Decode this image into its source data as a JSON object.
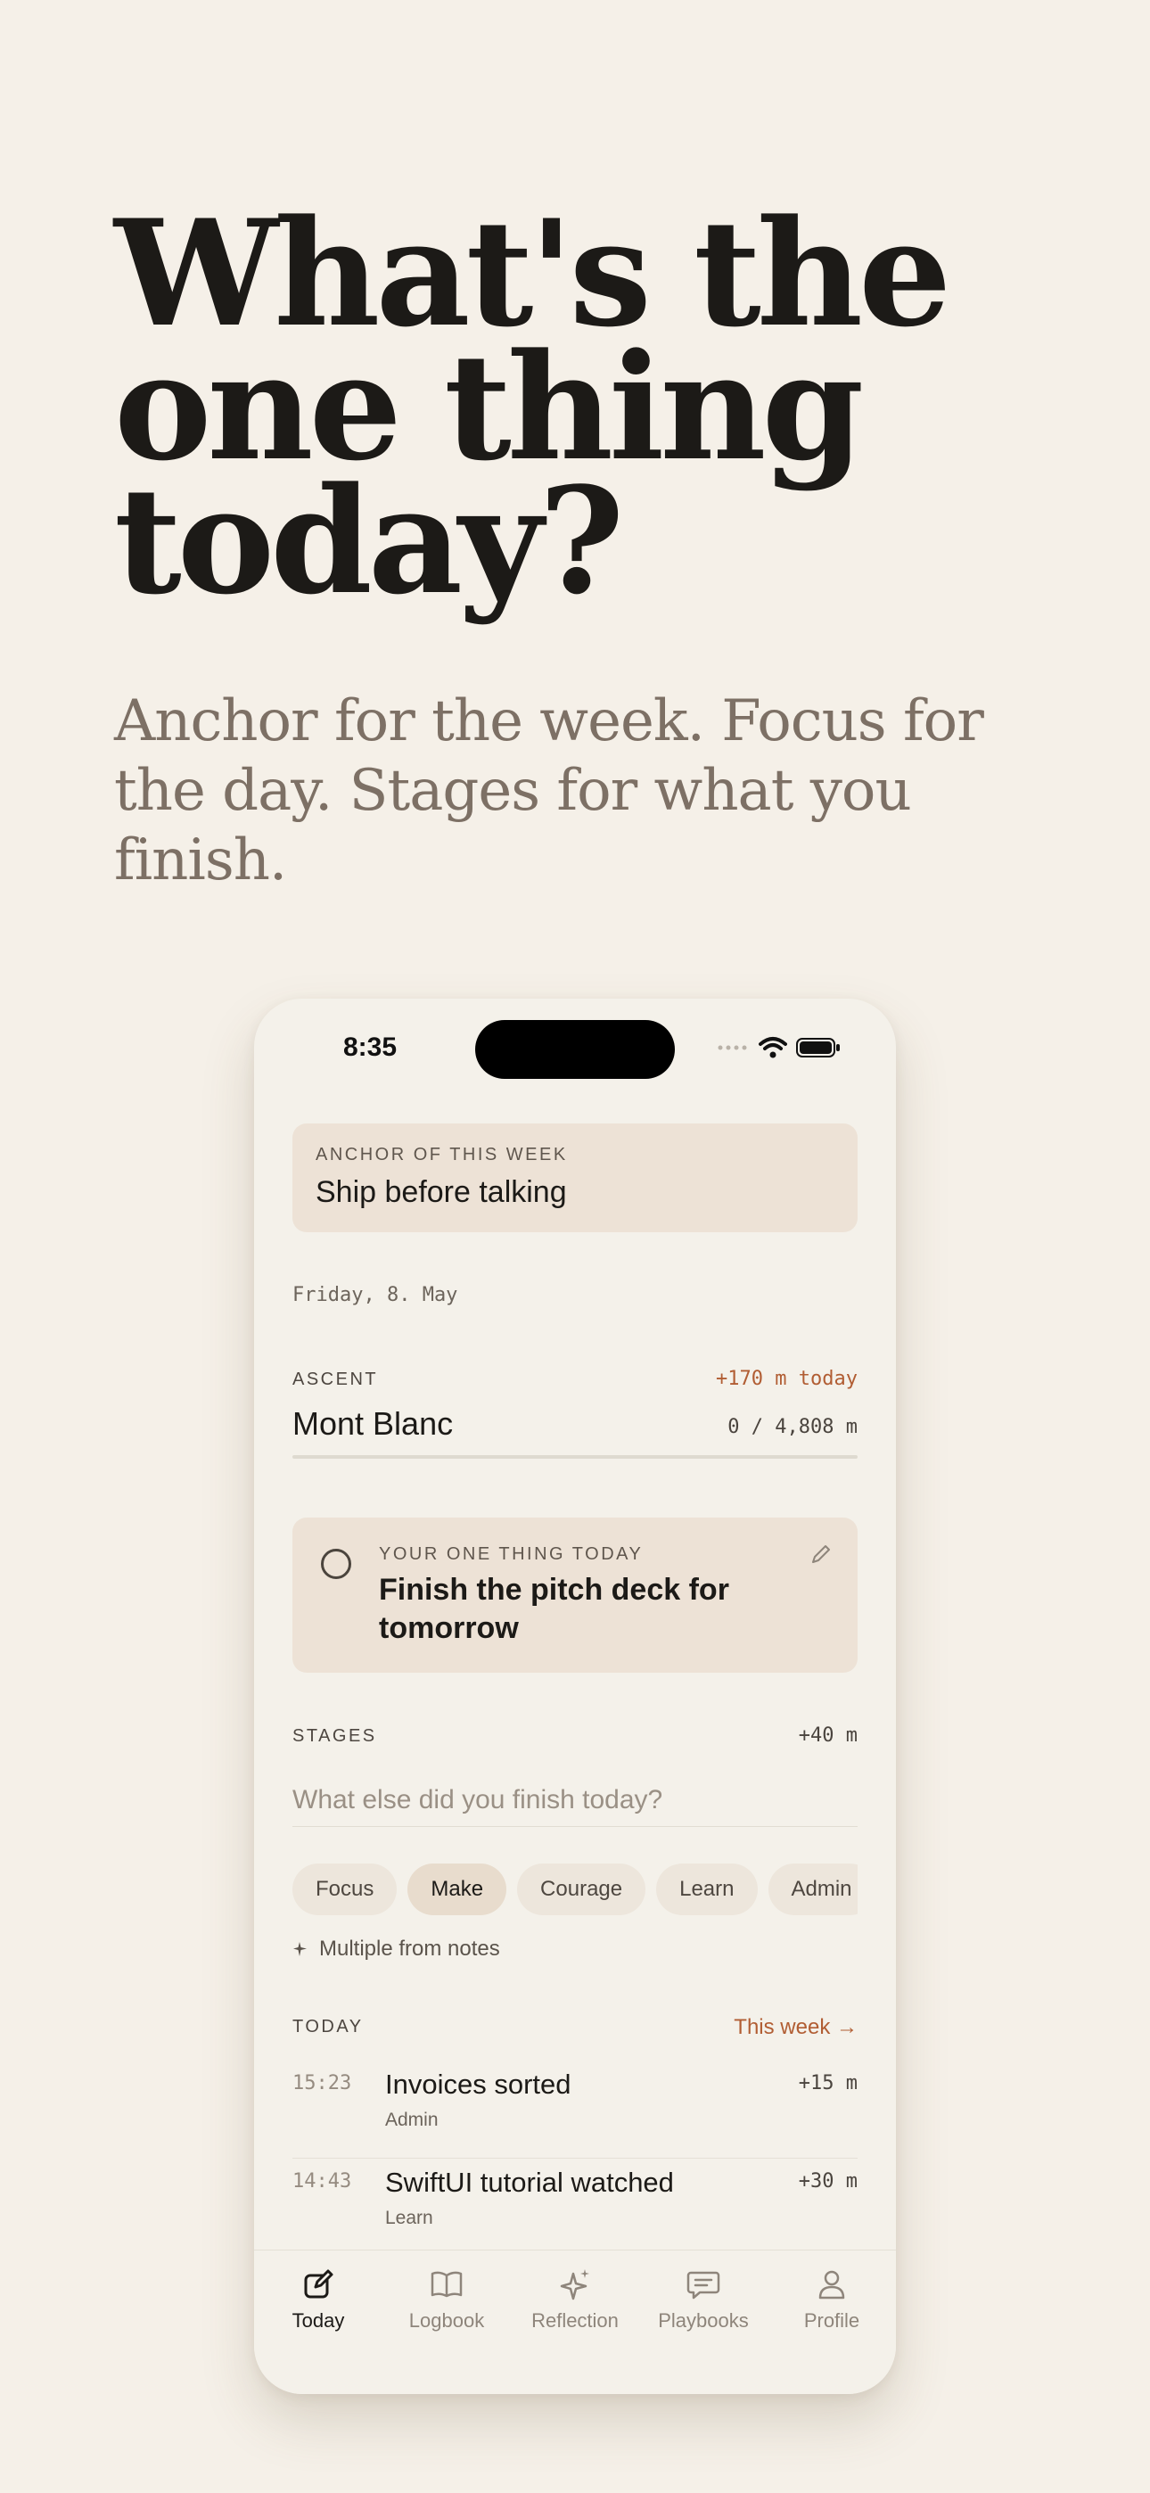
{
  "headline": "What's the one thing today?",
  "subheadline": "Anchor for the week. Focus for the day. Stages for what you finish.",
  "status_bar": {
    "time": "8:35"
  },
  "anchor": {
    "label": "ANCHOR OF THIS WEEK",
    "title": "Ship before talking"
  },
  "date": "Friday, 8. May",
  "ascent": {
    "label": "ASCENT",
    "today": "+170 m today",
    "mountain": "Mont Blanc",
    "progress_text": "0 / 4,808 m",
    "progress_fraction": 0
  },
  "one_thing": {
    "label": "YOUR ONE THING TODAY",
    "title": "Finish the pitch deck for tomorrow"
  },
  "stages": {
    "label": "STAGES",
    "value": "+40 m",
    "placeholder": "What else did you finish today?",
    "chips": [
      "Focus",
      "Make",
      "Courage",
      "Learn",
      "Admin"
    ],
    "selected_chip": "Make",
    "multi_label": "Multiple from notes"
  },
  "today": {
    "label": "TODAY",
    "link": "This week →",
    "entries": [
      {
        "time": "15:23",
        "title": "Invoices sorted",
        "category": "Admin",
        "meters": "+15 m"
      },
      {
        "time": "14:43",
        "title": "SwiftUI tutorial watched",
        "category": "Learn",
        "meters": "+30 m"
      }
    ]
  },
  "tabs": [
    {
      "label": "Today",
      "icon": "compose-icon",
      "active": true
    },
    {
      "label": "Logbook",
      "icon": "book-icon",
      "active": false
    },
    {
      "label": "Reflection",
      "icon": "sparkles-icon",
      "active": false
    },
    {
      "label": "Playbooks",
      "icon": "chat-bubble-icon",
      "active": false
    },
    {
      "label": "Profile",
      "icon": "person-icon",
      "active": false
    }
  ],
  "colors": {
    "background": "#f5f0e8",
    "card": "#ede2d6",
    "accent": "#b15d33",
    "text": "#1c1a17",
    "muted": "#7d7065"
  }
}
